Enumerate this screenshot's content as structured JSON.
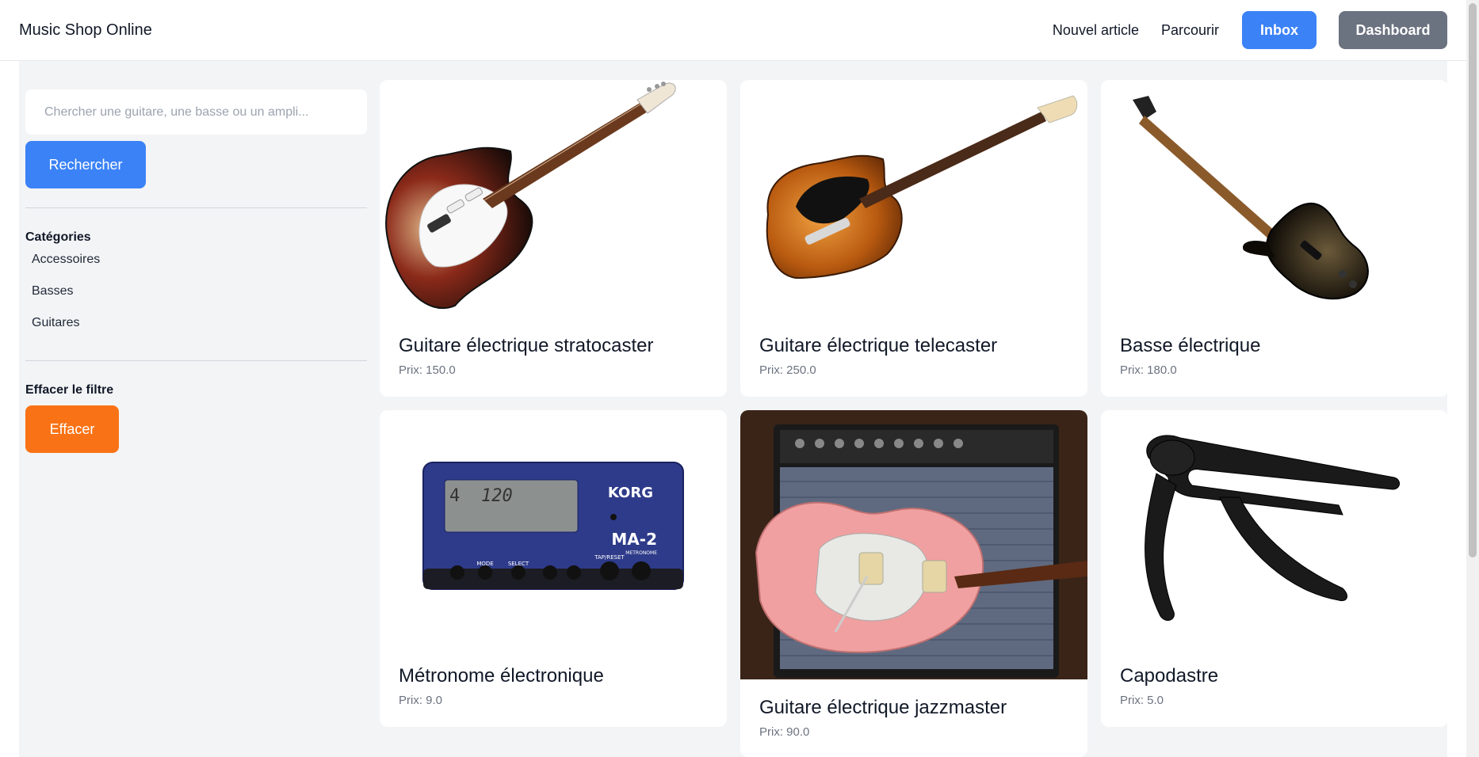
{
  "header": {
    "brand": "Music Shop Online",
    "nav": {
      "new_article": "Nouvel article",
      "browse": "Parcourir",
      "inbox": "Inbox",
      "dashboard": "Dashboard"
    }
  },
  "sidebar": {
    "search_placeholder": "Chercher une guitare, une basse ou un ampli...",
    "search_button": "Rechercher",
    "categories_title": "Catégories",
    "categories": [
      "Accessoires",
      "Basses",
      "Guitares"
    ],
    "clear_title": "Effacer le filtre",
    "clear_button": "Effacer"
  },
  "products": [
    {
      "title": "Guitare électrique stratocaster",
      "price": "Prix: 150.0",
      "image": "stratocaster-guitar"
    },
    {
      "title": "Guitare électrique telecaster",
      "price": "Prix: 250.0",
      "image": "telecaster-guitar"
    },
    {
      "title": "Basse électrique",
      "price": "Prix: 180.0",
      "image": "bass-guitar"
    },
    {
      "title": "Métronome électronique",
      "price": "Prix: 9.0",
      "image": "metronome"
    },
    {
      "title": "Guitare électrique jazzmaster",
      "price": "Prix: 90.0",
      "image": "jazzmaster-guitar"
    },
    {
      "title": "Capodastre",
      "price": "Prix: 5.0",
      "image": "capo"
    }
  ],
  "metronome_display": {
    "brand": "KORG",
    "model": "MA-2",
    "sub": "METRONOME",
    "beat": "4",
    "tempo": "120",
    "buttons": [
      "MODE",
      "SELECT",
      "TAP/RESET"
    ]
  },
  "colors": {
    "primary": "#3b82f6",
    "secondary": "#6b7280",
    "orange": "#f97316",
    "background": "#f3f4f6"
  }
}
